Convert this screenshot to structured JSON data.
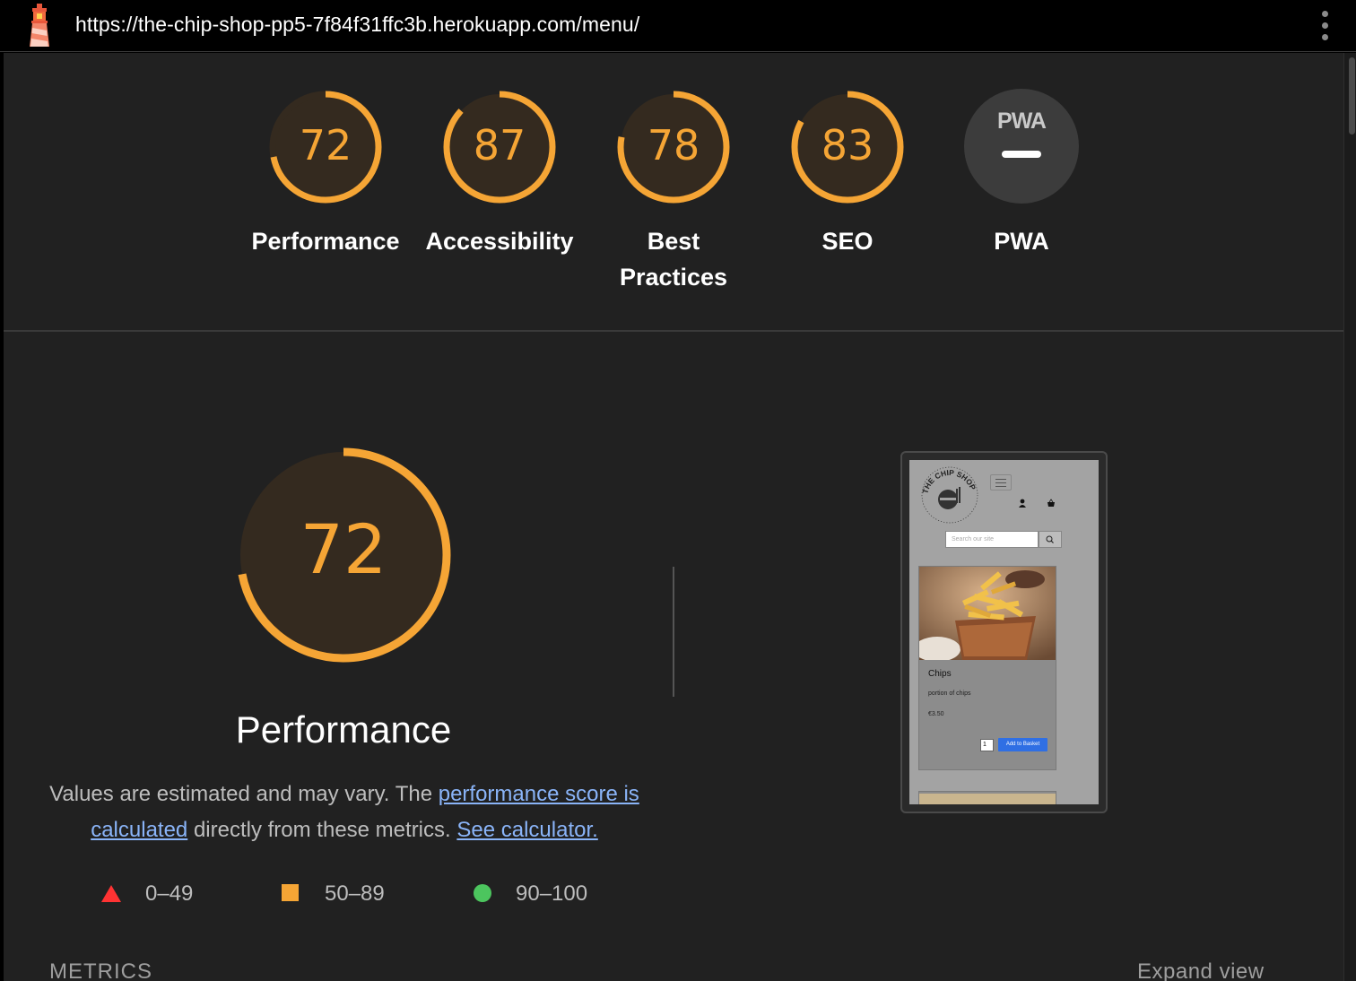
{
  "browser": {
    "url": "https://the-chip-shop-pp5-7f84f31ffc3b.herokuapp.com/menu/"
  },
  "colors": {
    "average": "#f5a535",
    "fail": "#ff3333",
    "pass": "#4cc55e",
    "link": "#8ab4f8"
  },
  "scores": [
    {
      "label": "Performance",
      "score": "72",
      "value": 72
    },
    {
      "label": "Accessibility",
      "score": "87",
      "value": 87
    },
    {
      "label": "Best Practices",
      "score": "78",
      "value": 78
    },
    {
      "label": "SEO",
      "score": "83",
      "value": 83
    }
  ],
  "pwa": {
    "badge": "PWA",
    "label": "PWA"
  },
  "performance": {
    "score": "72",
    "value": 72,
    "title": "Performance",
    "desc_prefix": "Values are estimated and may vary. The ",
    "desc_link1": "performance score is calculated",
    "desc_middle": " directly from these metrics. ",
    "desc_link2": "See calculator."
  },
  "legend": [
    {
      "shape": "triangle",
      "range": "0–49"
    },
    {
      "shape": "square",
      "range": "50–89"
    },
    {
      "shape": "circle",
      "range": "90–100"
    }
  ],
  "metrics_heading": "METRICS",
  "expand_view": "Expand view",
  "screenshot": {
    "logo_text": "THE CHIP SHOP",
    "search_placeholder": "Search our site",
    "product_name": "Chips",
    "product_desc": "portion of chips",
    "product_price": "€3.50",
    "qty": "1",
    "add_button": "Add to Basket"
  }
}
